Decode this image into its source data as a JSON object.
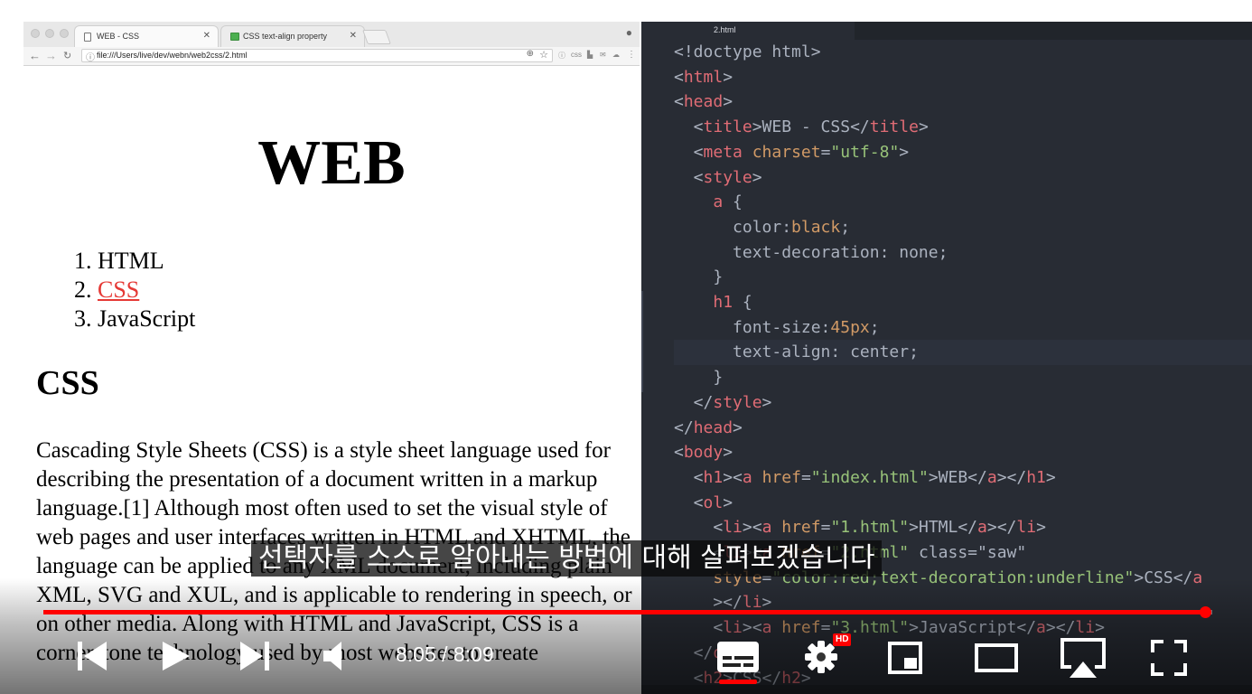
{
  "browser": {
    "tabs": [
      {
        "label": "WEB - CSS",
        "icon": "page-icon",
        "active": true
      },
      {
        "label": "CSS text-align property",
        "icon": "w3schools-icon",
        "active": false
      }
    ],
    "url": "file:///Users/live/dev/webn/web2css/2.html",
    "page": {
      "h1": "WEB",
      "nav_items": [
        {
          "number": "1.",
          "label": "HTML"
        },
        {
          "number": "2.",
          "label": "CSS"
        },
        {
          "number": "3.",
          "label": "JavaScript"
        }
      ],
      "h2": "CSS",
      "paragraph": "Cascading Style Sheets (CSS) is a style sheet language used for describing the presentation of a document written in a markup language.[1] Although most often used to set the visual style of web pages and user interfaces written in HTML and XHTML, the language can be applied to any XML document, including plain XML, SVG and XUL, and is applicable to rendering in speech, or on other media. Along with HTML and JavaScript, CSS is a cornerstone technology used by most websites to create"
    },
    "colors": {
      "link_active": "#e53935"
    }
  },
  "editor": {
    "tab_label": "2.html",
    "lines": [
      [
        [
          "pun",
          "<!doctype html>"
        ]
      ],
      [
        [
          "pun",
          "<"
        ],
        [
          "tag",
          "html"
        ],
        [
          "pun",
          ">"
        ]
      ],
      [
        [
          "pun",
          "<"
        ],
        [
          "tag",
          "head"
        ],
        [
          "pun",
          ">"
        ]
      ],
      [
        [
          "pun",
          "  <"
        ],
        [
          "tag",
          "title"
        ],
        [
          "pun",
          ">WEB - CSS</"
        ],
        [
          "tag",
          "title"
        ],
        [
          "pun",
          ">"
        ]
      ],
      [
        [
          "pun",
          "  <"
        ],
        [
          "tag",
          "meta"
        ],
        [
          "pun",
          " "
        ],
        [
          "attr",
          "charset"
        ],
        [
          "pun",
          "="
        ],
        [
          "str",
          "\"utf-8\""
        ],
        [
          "pun",
          ">"
        ]
      ],
      [
        [
          "pun",
          "  <"
        ],
        [
          "tag",
          "style"
        ],
        [
          "pun",
          ">"
        ]
      ],
      [
        [
          "pun",
          "    "
        ],
        [
          "tag",
          "a"
        ],
        [
          "pun",
          " {"
        ]
      ],
      [
        [
          "pun",
          "      color:"
        ],
        [
          "attr",
          "black"
        ],
        [
          "pun",
          ";"
        ]
      ],
      [
        [
          "pun",
          "      text-decoration: none;"
        ]
      ],
      [
        [
          "pun",
          "    }"
        ]
      ],
      [
        [
          "pun",
          "    "
        ],
        [
          "tag",
          "h1"
        ],
        [
          "pun",
          " {"
        ]
      ],
      [
        [
          "pun",
          "      font-size:"
        ],
        [
          "num",
          "45px"
        ],
        [
          "pun",
          ";"
        ]
      ],
      [
        [
          "pun",
          "      text-align: center;"
        ]
      ],
      [
        [
          "pun",
          "    }"
        ]
      ],
      [
        [
          "pun",
          "  </"
        ],
        [
          "tag",
          "style"
        ],
        [
          "pun",
          ">"
        ]
      ],
      [
        [
          "pun",
          "</"
        ],
        [
          "tag",
          "head"
        ],
        [
          "pun",
          ">"
        ]
      ],
      [
        [
          "pun",
          "<"
        ],
        [
          "tag",
          "body"
        ],
        [
          "pun",
          ">"
        ]
      ],
      [
        [
          "pun",
          "  <"
        ],
        [
          "tag",
          "h1"
        ],
        [
          "pun",
          "><"
        ],
        [
          "tag",
          "a"
        ],
        [
          "pun",
          " "
        ],
        [
          "attr",
          "href"
        ],
        [
          "pun",
          "="
        ],
        [
          "str",
          "\"index.html\""
        ],
        [
          "pun",
          ">WEB</"
        ],
        [
          "tag",
          "a"
        ],
        [
          "pun",
          "></"
        ],
        [
          "tag",
          "h1"
        ],
        [
          "pun",
          ">"
        ]
      ],
      [
        [
          "pun",
          "  <"
        ],
        [
          "tag",
          "ol"
        ],
        [
          "pun",
          ">"
        ]
      ],
      [
        [
          "pun",
          "    <"
        ],
        [
          "tag",
          "li"
        ],
        [
          "pun",
          "><"
        ],
        [
          "tag",
          "a"
        ],
        [
          "pun",
          " "
        ],
        [
          "attr",
          "href"
        ],
        [
          "pun",
          "="
        ],
        [
          "str",
          "\"1.html\""
        ],
        [
          "pun",
          ">HTML</"
        ],
        [
          "tag",
          "a"
        ],
        [
          "pun",
          "></"
        ],
        [
          "tag",
          "li"
        ],
        [
          "pun",
          ">"
        ]
      ],
      [
        [
          "pun",
          "    <"
        ],
        [
          "tag",
          "li"
        ],
        [
          "pun",
          "><"
        ],
        [
          "tag",
          "a"
        ],
        [
          "pun",
          " "
        ],
        [
          "attr",
          "href"
        ],
        [
          "pun",
          "="
        ],
        [
          "str",
          "\"2.html\""
        ],
        [
          "pun",
          " class=\"saw\""
        ]
      ],
      [
        [
          "pun",
          "    "
        ],
        [
          "attr",
          "style"
        ],
        [
          "pun",
          "="
        ],
        [
          "str",
          "\"color:red;text-decoration:underline\""
        ],
        [
          "pun",
          ">CSS</"
        ],
        [
          "tag",
          "a"
        ]
      ],
      [
        [
          "pun",
          "    ></"
        ],
        [
          "tag",
          "li"
        ],
        [
          "pun",
          ">"
        ]
      ],
      [
        [
          "pun",
          "    <"
        ],
        [
          "tag",
          "li"
        ],
        [
          "pun",
          "><"
        ],
        [
          "tag",
          "a"
        ],
        [
          "pun",
          " "
        ],
        [
          "attr",
          "href"
        ],
        [
          "pun",
          "="
        ],
        [
          "str",
          "\"3.html\""
        ],
        [
          "pun",
          ">JavaScript</"
        ],
        [
          "tag",
          "a"
        ],
        [
          "pun",
          "></"
        ],
        [
          "tag",
          "li"
        ],
        [
          "pun",
          ">"
        ]
      ],
      [
        [
          "pun",
          "  </"
        ],
        [
          "tag",
          "ol"
        ],
        [
          "pun",
          ">"
        ]
      ],
      [
        [
          "pun",
          "  <"
        ],
        [
          "tag",
          "h2"
        ],
        [
          "pun",
          ">CSS</"
        ],
        [
          "tag",
          "h2"
        ],
        [
          "pun",
          ">"
        ]
      ]
    ],
    "highlight_line": 12,
    "colors": {
      "background": "#282c34",
      "tag": "#e06c75",
      "attr": "#d19a66",
      "string": "#98c379"
    }
  },
  "video": {
    "subtitle": "선택자를 스스로 알아내는 방법에 대해 살펴보겠습니다",
    "time": "8:05 / 8:09",
    "progress": 0.994,
    "hd_badge": "HD",
    "controls": [
      "previous-icon",
      "play-icon",
      "next-icon",
      "volume-icon",
      "captions-icon",
      "settings-icon",
      "miniplayer-icon",
      "theater-icon",
      "airplay-icon",
      "fullscreen-icon"
    ]
  }
}
